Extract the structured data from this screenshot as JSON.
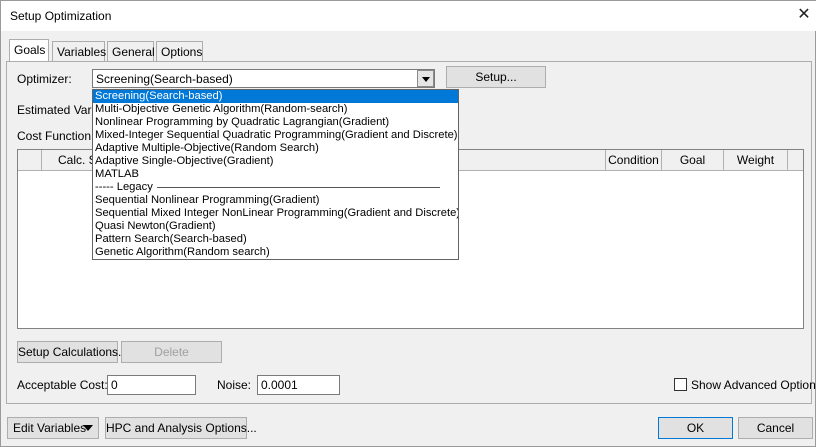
{
  "window": {
    "title": "Setup Optimization",
    "close_glyph": "✕"
  },
  "tabs": [
    {
      "label": "Goals",
      "active": true
    },
    {
      "label": "Variables",
      "active": false
    },
    {
      "label": "General",
      "active": false
    },
    {
      "label": "Options",
      "active": false
    }
  ],
  "goals": {
    "optimizer_label": "Optimizer:",
    "optimizer_value": "Screening(Search-based)",
    "setup_button": "Setup...",
    "estimated_label": "Estimated Variat",
    "cost_function_label": "Cost Function:",
    "grid_headers": [
      "",
      "Calc. S",
      "Condition",
      "Goal",
      "Weight"
    ],
    "setup_calculations_button": "Setup Calculations...",
    "delete_button": "Delete",
    "acceptable_cost_label": "Acceptable Cost:",
    "acceptable_cost_value": "0",
    "noise_label": "Noise:",
    "noise_value": "0.0001",
    "show_advanced_label": "Show Advanced Option",
    "show_advanced_checked": false
  },
  "dropdown": {
    "options": [
      "Screening(Search-based)",
      "Multi-Objective Genetic Algorithm(Random-search)",
      "Nonlinear Programming by Quadratic Lagrangian(Gradient)",
      "Mixed-Integer Sequential Quadratic Programming(Gradient and Discrete)",
      "Adaptive Multiple-Objective(Random Search)",
      "Adaptive Single-Objective(Gradient)",
      "MATLAB",
      "----- Legacy",
      "Sequential Nonlinear Programming(Gradient)",
      "Sequential Mixed Integer NonLinear Programming(Gradient and Discrete)",
      "Quasi Newton(Gradient)",
      "Pattern Search(Search-based)",
      "Genetic Algorithm(Random search)"
    ],
    "selected_index": 0,
    "separator_index": 7
  },
  "footer": {
    "edit_variables_button": "Edit Variables",
    "hpc_button": "HPC and Analysis Options...",
    "ok_button": "OK",
    "cancel_button": "Cancel"
  },
  "colors": {
    "selection": "#0078d7",
    "window_bg": "#f0f0f0"
  },
  "icons": {
    "close": "close-icon",
    "combo_arrow": "chevron-down-icon",
    "edit_arrow": "caret-down-icon"
  }
}
